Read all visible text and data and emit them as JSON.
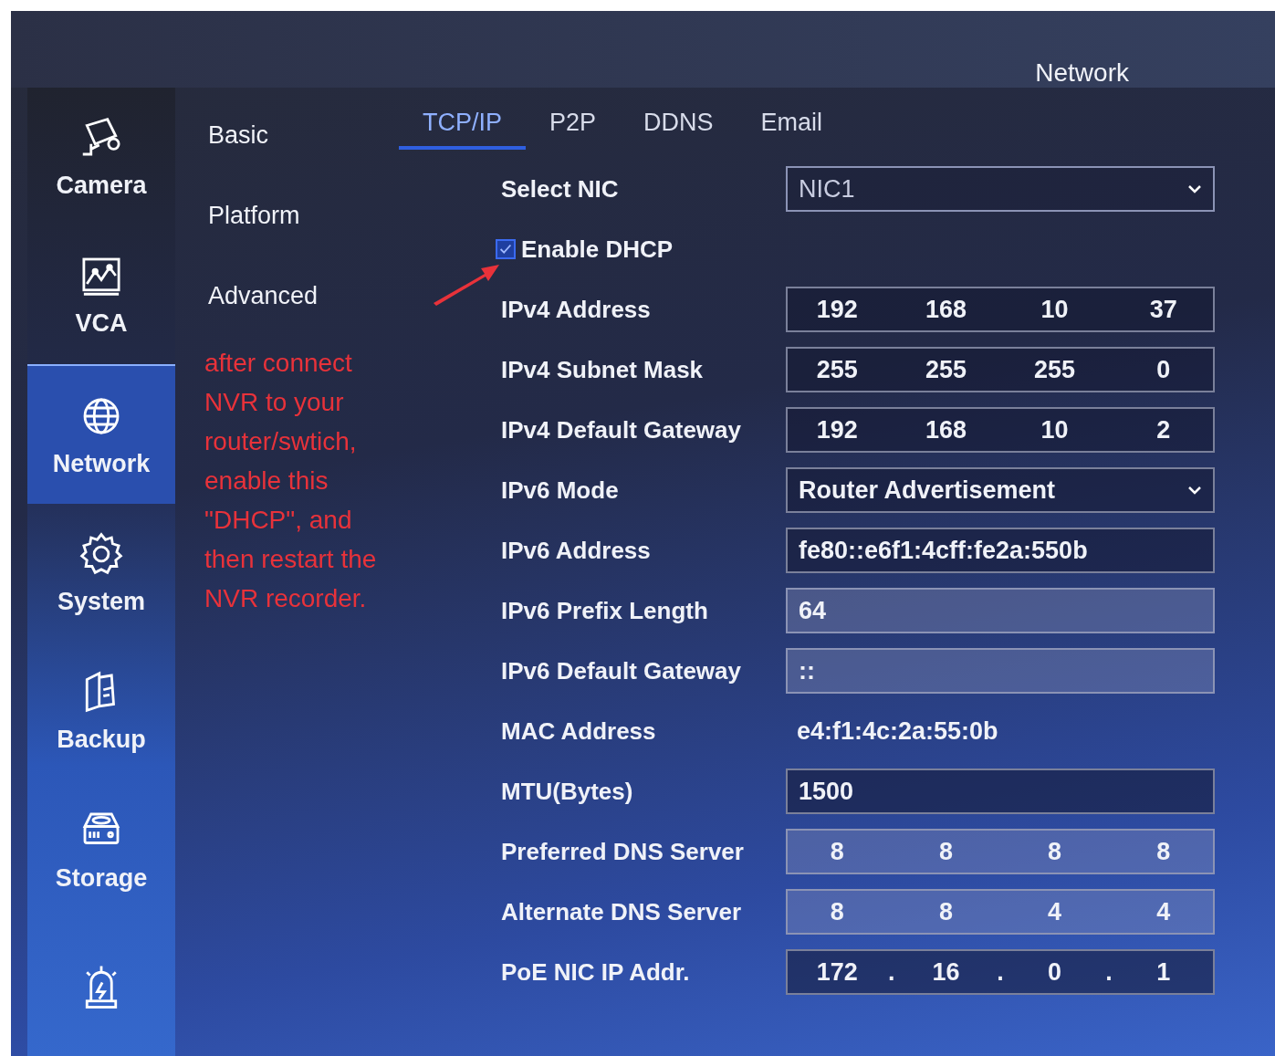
{
  "header": {
    "title": "Network"
  },
  "sidebar": [
    {
      "label": "Camera",
      "selected": false
    },
    {
      "label": "VCA",
      "selected": false
    },
    {
      "label": "Network",
      "selected": true
    },
    {
      "label": "System",
      "selected": false
    },
    {
      "label": "Backup",
      "selected": false
    },
    {
      "label": "Storage",
      "selected": false
    },
    {
      "selected": false
    }
  ],
  "submenu": [
    {
      "label": "Basic"
    },
    {
      "label": "Platform"
    },
    {
      "label": "Advanced"
    }
  ],
  "tabs": [
    {
      "label": "TCP/IP",
      "selected": true
    },
    {
      "label": "P2P",
      "selected": false
    },
    {
      "label": "DDNS",
      "selected": false
    },
    {
      "label": "Email",
      "selected": false
    }
  ],
  "form": [
    {
      "kind": "select",
      "label": "Select NIC",
      "value": "NIC1",
      "disabled": true
    },
    {
      "kind": "checkbox",
      "label": "Enable DHCP",
      "checked": true
    },
    {
      "kind": "ip",
      "label": "IPv4 Address",
      "octets": [
        "192",
        "168",
        "10",
        "37"
      ],
      "disabled": false
    },
    {
      "kind": "ip",
      "label": "IPv4 Subnet Mask",
      "octets": [
        "255",
        "255",
        "255",
        "0"
      ],
      "disabled": false
    },
    {
      "kind": "ip",
      "label": "IPv4 Default Gateway",
      "octets": [
        "192",
        "168",
        "10",
        "2"
      ],
      "disabled": false
    },
    {
      "kind": "select",
      "label": "IPv6 Mode",
      "value": "Router Advertisement",
      "disabled": false
    },
    {
      "kind": "text",
      "label": "IPv6 Address",
      "value": "fe80::e6f1:4cff:fe2a:550b",
      "disabled": false
    },
    {
      "kind": "text",
      "label": "IPv6 Prefix Length",
      "value": "64",
      "disabled": true
    },
    {
      "kind": "text",
      "label": "IPv6 Default Gateway",
      "value": "::",
      "disabled": true
    },
    {
      "kind": "plain",
      "label": "MAC Address",
      "value": "e4:f1:4c:2a:55:0b"
    },
    {
      "kind": "text",
      "label": "MTU(Bytes)",
      "value": "1500",
      "disabled": false
    },
    {
      "kind": "ip",
      "label": "Preferred DNS Server",
      "octets": [
        "8",
        "8",
        "8",
        "8"
      ],
      "disabled": true
    },
    {
      "kind": "ip",
      "label": "Alternate DNS Server",
      "octets": [
        "8",
        "8",
        "4",
        "4"
      ],
      "disabled": true
    },
    {
      "kind": "ip",
      "label": "PoE NIC IP Addr.",
      "octets": [
        "172",
        "16",
        "0",
        "1"
      ],
      "separators": [
        ".",
        ".",
        "."
      ],
      "disabled": false
    }
  ],
  "annotation": {
    "text": "after connect NVR to your router/swtich, enable this \"DHCP\", and then restart the NVR recorder."
  }
}
